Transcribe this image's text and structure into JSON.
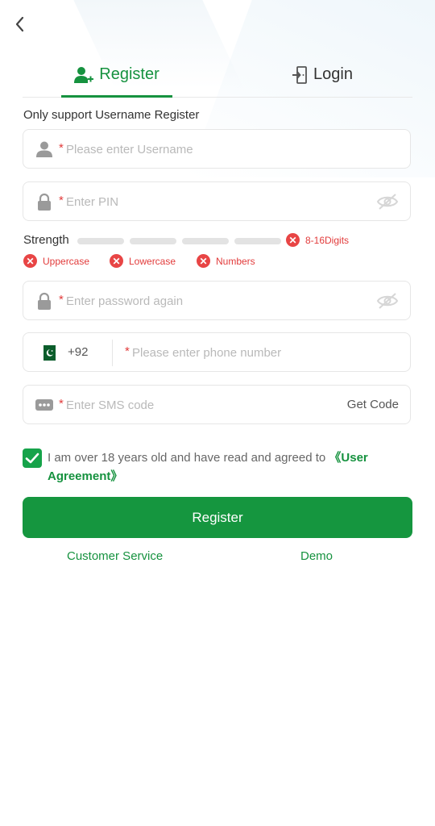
{
  "tabs": {
    "register": "Register",
    "login": "Login"
  },
  "hint": "Only support Username Register",
  "fields": {
    "username_placeholder": "Please enter Username",
    "pin_placeholder": "Enter PIN",
    "password_again_placeholder": "Enter password again",
    "country_code": "+92",
    "phone_placeholder": "Please enter phone number",
    "sms_placeholder": "Enter SMS code",
    "get_code": "Get Code",
    "required_mark": "*"
  },
  "strength": {
    "label": "Strength",
    "checks": {
      "length": "8-16Digits",
      "uppercase": "Uppercase",
      "lowercase": "Lowercase",
      "numbers": "Numbers"
    }
  },
  "agreement": {
    "text": "I am over 18 years old and have read and agreed to ",
    "link": "《User Agreement》",
    "checked": true
  },
  "actions": {
    "register": "Register",
    "customer_service": "Customer Service",
    "demo": "Demo"
  },
  "colors": {
    "accent": "#16923f",
    "error": "#e23b3b"
  },
  "icons": {
    "back": "back-arrow-icon",
    "register_tab": "user-add-icon",
    "login_tab": "door-exit-icon",
    "username": "user-icon",
    "pin": "lock-icon",
    "password": "lock-icon",
    "eye": "eye-off-icon",
    "flag": "pakistan-flag-icon",
    "sms": "sms-dots-icon",
    "check": "checkmark-icon",
    "error": "x-circle-icon"
  }
}
